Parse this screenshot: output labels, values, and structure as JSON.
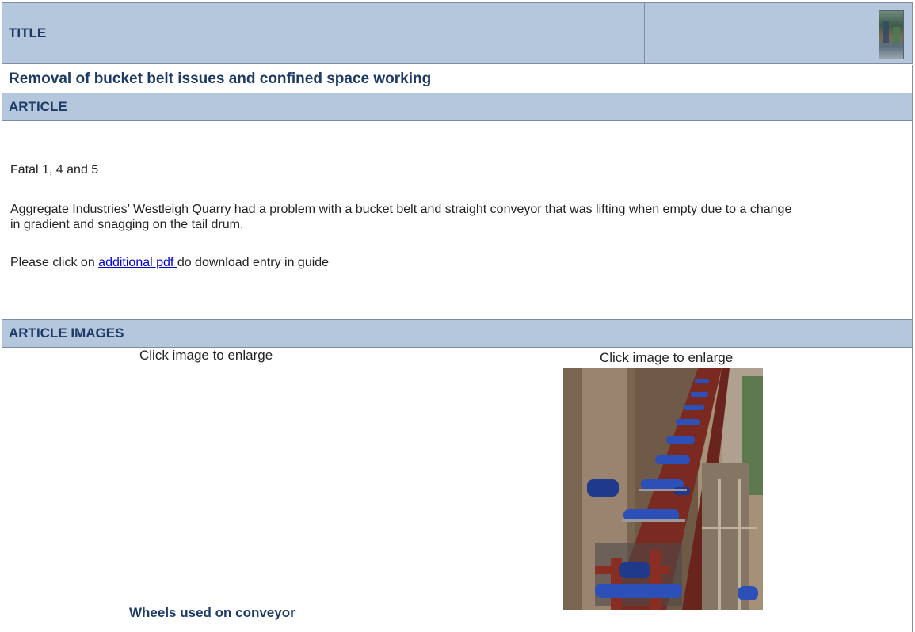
{
  "header": {
    "title_label": "TITLE",
    "thumbnail_icon": "site-photo-thumbnail"
  },
  "article": {
    "title": "Removal of bucket belt issues and confined space working",
    "section_label": "ARTICLE",
    "fatal_ref": "Fatal 1, 4 and 5",
    "description": "Aggregate Industries’ Westleigh Quarry had a problem with a bucket belt and straight conveyor that was lifting when empty due to a change in gradient and snagging on the tail drum.",
    "download_prefix": "Please click on ",
    "download_link": "additional pdf ",
    "download_suffix": "do download entry in guide"
  },
  "images": {
    "section_label": "ARTICLE IMAGES",
    "enlarge_left": "Click image to enlarge",
    "enlarge_right": "Click image to enlarge",
    "caption_left": "Wheels used on conveyor"
  },
  "colors": {
    "header_bg": "#b5c7dc",
    "heading_text": "#1e3a66",
    "border": "#7f8d9e",
    "link": "#0000cc"
  }
}
